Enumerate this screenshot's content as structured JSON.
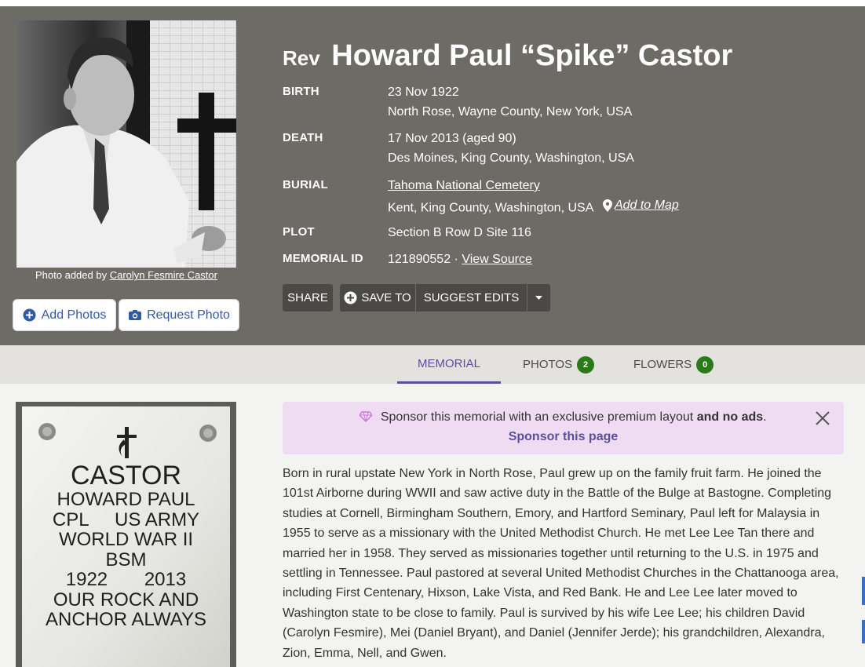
{
  "memorial": {
    "name_prefix": "Rev",
    "name": "Howard Paul “Spike” Castor",
    "photo_credit_prefix": "Photo added by",
    "photo_credit_name": "Carolyn Fesmire Castor",
    "add_photos": "Add Photos",
    "request_photo": "Request Photo"
  },
  "facts": {
    "birth_label": "BIRTH",
    "birth_date": "23 Nov 1922",
    "birth_place": "North Rose, Wayne County, New York, USA",
    "death_label": "DEATH",
    "death_date": "17 Nov 2013 (aged 90)",
    "death_place": "Des Moines, King County, Washington, USA",
    "burial_label": "BURIAL",
    "burial_cemetery": "Tahoma National Cemetery",
    "burial_place": "Kent, King County, Washington, USA",
    "add_to_map": "Add to Map",
    "plot_label": "PLOT",
    "plot_value": "Section B Row D Site 116",
    "memorial_id_label": "MEMORIAL ID",
    "memorial_id": "121890552 ·",
    "view_source": "View Source"
  },
  "actions": {
    "share": "SHARE",
    "save_to": "SAVE TO",
    "suggest_edits": "SUGGEST EDITS"
  },
  "tabs": {
    "memorial": "MEMORIAL",
    "photos": "PHOTOS",
    "photos_count": "2",
    "flowers": "FLOWERS",
    "flowers_count": "0"
  },
  "sponsor": {
    "text": "Sponsor this memorial with an exclusive premium layout",
    "text_bold": "and no ads",
    "text_end": ".",
    "link": "Sponsor this page"
  },
  "headstone": {
    "line1": "CASTOR",
    "line2": "HOWARD PAUL",
    "line3": "CPL     US ARMY",
    "line4": "WORLD WAR II",
    "line5": "BSM",
    "line6": "1922       2013",
    "line7": "OUR ROCK AND",
    "line8": "ANCHOR ALWAYS"
  },
  "bio": "Born in rural upstate New York in North Rose, Paul grew up on the family fruit farm. He joined the 101st Airborne during WWII and saw active duty in the Battle of the Bulge at Bastogne. Completing studies at Cornell, Birmingham Southern, Emory, and Hartford Seminary, Paul left for Malaysia in 1955 to serve as a missionary with the United Methodist Church. He met Lee Lee Tan there and married her in 1958. They served as missionaries together until returning to the U.S. in 1975 and settling in Tennessee. Paul pastored at several United Methodist Churches in the Chattanooga area, including First Centenary, Hixson, Lake Vista, and Red Bank. He and Lee Lee later moved to Washington state to be close to family. Paul is survived by his wife Lee Lee; his children David (Carolyn Fesmire), Mei (Daniel Bryant), and Daniel (Jennifer Jerde); his grandchildren, Alexandra, Zion, Emma, Nell, and Gwen.",
  "colors": {
    "header_bg": "#6d6b66",
    "accent": "#5a4f9a",
    "badge": "#2a7a18",
    "sponsor_bg": "#efdcf2"
  }
}
